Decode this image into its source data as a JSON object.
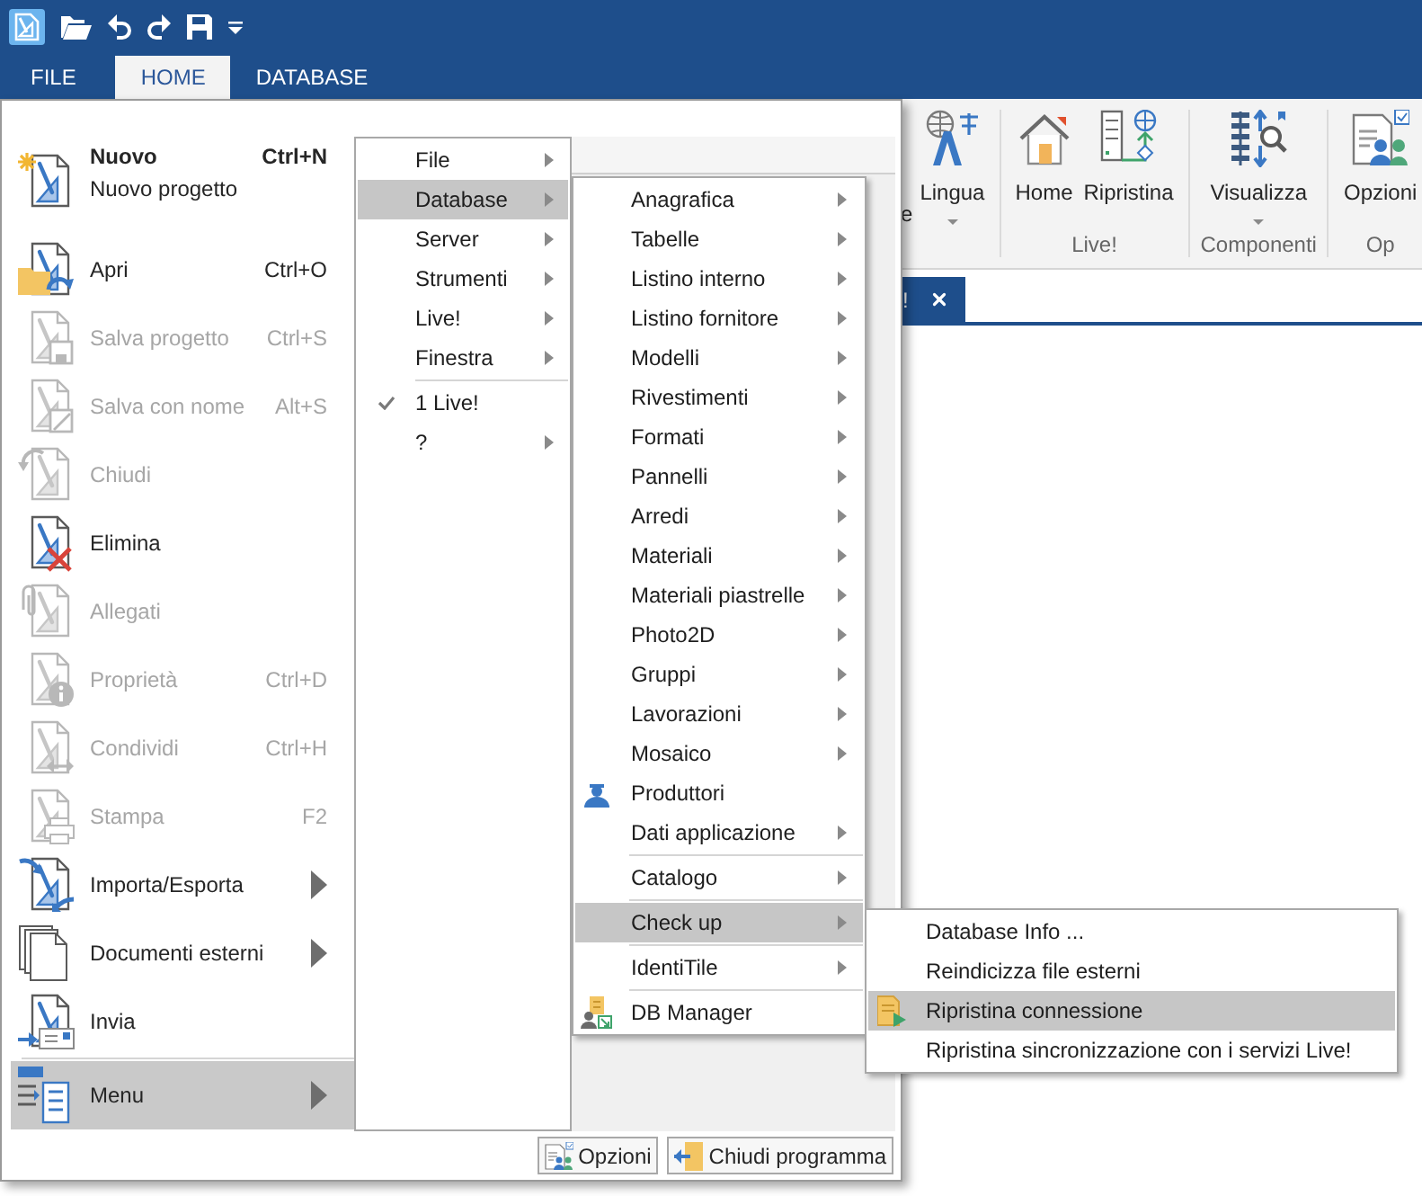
{
  "tabs": [
    {
      "label": "FILE",
      "selected": false
    },
    {
      "label": "HOME",
      "selected": true
    },
    {
      "label": "DATABASE",
      "selected": false
    }
  ],
  "ribbon": {
    "cut_label": "e",
    "groups": [
      {
        "buttons": [
          {
            "label": "Lingua",
            "dropdown": true
          }
        ]
      },
      {
        "label": "Live!",
        "buttons": [
          {
            "label": "Home",
            "dropdown": false
          },
          {
            "label": "Ripristina",
            "dropdown": false
          }
        ]
      },
      {
        "label": "Componenti",
        "buttons": [
          {
            "label": "Visualizza",
            "dropdown": true
          }
        ]
      },
      {
        "label": "Op",
        "buttons": [
          {
            "label": "Opzioni",
            "dropdown": false
          }
        ]
      }
    ]
  },
  "document_tab": {
    "label": "!"
  },
  "backstage": {
    "groups": [
      [
        {
          "label": "Nuovo",
          "description": "Nuovo progetto",
          "shortcut": "Ctrl+N",
          "disabled": false,
          "submenu": false,
          "selected": false
        },
        {
          "label": "Apri",
          "shortcut": "Ctrl+O",
          "disabled": false,
          "submenu": false,
          "selected": false
        },
        {
          "label": "Salva progetto",
          "shortcut": "Ctrl+S",
          "disabled": true,
          "submenu": false,
          "selected": false
        },
        {
          "label": "Salva con nome",
          "shortcut": "Alt+S",
          "disabled": true,
          "submenu": false,
          "selected": false
        },
        {
          "label": "Chiudi",
          "disabled": true,
          "submenu": false,
          "selected": false
        },
        {
          "label": "Elimina",
          "disabled": false,
          "submenu": false,
          "selected": false
        },
        {
          "label": "Allegati",
          "disabled": true,
          "submenu": false,
          "selected": false
        },
        {
          "label": "Proprietà",
          "shortcut": "Ctrl+D",
          "disabled": true,
          "submenu": false,
          "selected": false
        },
        {
          "label": "Condividi",
          "shortcut": "Ctrl+H",
          "disabled": true,
          "submenu": false,
          "selected": false
        },
        {
          "label": "Stampa",
          "shortcut": "F2",
          "disabled": true,
          "submenu": false,
          "selected": false
        },
        {
          "label": "Importa/Esporta",
          "disabled": false,
          "submenu": true,
          "selected": false
        },
        {
          "label": "Documenti esterni",
          "disabled": false,
          "submenu": true,
          "selected": false
        },
        {
          "label": "Invia",
          "disabled": false,
          "submenu": false,
          "selected": false
        }
      ],
      [
        {
          "label": "Menu",
          "disabled": false,
          "submenu": true,
          "selected": true
        }
      ]
    ],
    "footer_buttons": [
      {
        "label": "Opzioni"
      },
      {
        "label": "Chiudi programma"
      }
    ]
  },
  "menu_tree": {
    "groups": [
      [
        {
          "label": "File",
          "submenu": true,
          "checked": false,
          "selected": false
        },
        {
          "label": "Database",
          "submenu": true,
          "checked": false,
          "selected": true
        },
        {
          "label": "Server",
          "submenu": true,
          "checked": false,
          "selected": false
        },
        {
          "label": "Strumenti",
          "submenu": true,
          "checked": false,
          "selected": false
        },
        {
          "label": "Live!",
          "submenu": true,
          "checked": false,
          "selected": false
        },
        {
          "label": "Finestra",
          "submenu": true,
          "checked": false,
          "selected": false
        }
      ],
      [
        {
          "label": "1 Live!",
          "submenu": false,
          "checked": true,
          "selected": false
        },
        {
          "label": "?",
          "submenu": true,
          "checked": false,
          "selected": false
        }
      ]
    ]
  },
  "database_menu": {
    "groups": [
      [
        {
          "label": "Anagrafica",
          "submenu": true,
          "selected": false
        },
        {
          "label": "Tabelle",
          "submenu": true,
          "selected": false
        },
        {
          "label": "Listino interno",
          "submenu": true,
          "selected": false
        },
        {
          "label": "Listino fornitore",
          "submenu": true,
          "selected": false
        },
        {
          "label": "Modelli",
          "submenu": true,
          "selected": false
        },
        {
          "label": "Rivestimenti",
          "submenu": true,
          "selected": false
        },
        {
          "label": "Formati",
          "submenu": true,
          "selected": false
        },
        {
          "label": "Pannelli",
          "submenu": true,
          "selected": false
        },
        {
          "label": "Arredi",
          "submenu": true,
          "selected": false
        },
        {
          "label": "Materiali",
          "submenu": true,
          "selected": false
        },
        {
          "label": "Materiali piastrelle",
          "submenu": true,
          "selected": false
        },
        {
          "label": "Photo2D",
          "submenu": true,
          "selected": false
        },
        {
          "label": "Gruppi",
          "submenu": true,
          "selected": false
        },
        {
          "label": "Lavorazioni",
          "submenu": true,
          "selected": false
        },
        {
          "label": "Mosaico",
          "submenu": true,
          "selected": false
        },
        {
          "label": "Produttori",
          "submenu": false,
          "selected": false
        },
        {
          "label": "Dati applicazione",
          "submenu": true,
          "selected": false
        }
      ],
      [
        {
          "label": "Catalogo",
          "submenu": true,
          "selected": false
        }
      ],
      [
        {
          "label": "Check up",
          "submenu": true,
          "selected": true
        }
      ],
      [
        {
          "label": "IdentiTile",
          "submenu": true,
          "selected": false
        }
      ],
      [
        {
          "label": "DB Manager",
          "submenu": false,
          "selected": false
        }
      ]
    ]
  },
  "checkup_menu": {
    "items": [
      {
        "label": "Database Info ...",
        "selected": false
      },
      {
        "label": "Reindicizza file esterni",
        "selected": false
      },
      {
        "label": "Ripristina connessione",
        "selected": true
      },
      {
        "label": "Ripristina sincronizzazione con i servizi Live!",
        "selected": false
      }
    ]
  }
}
